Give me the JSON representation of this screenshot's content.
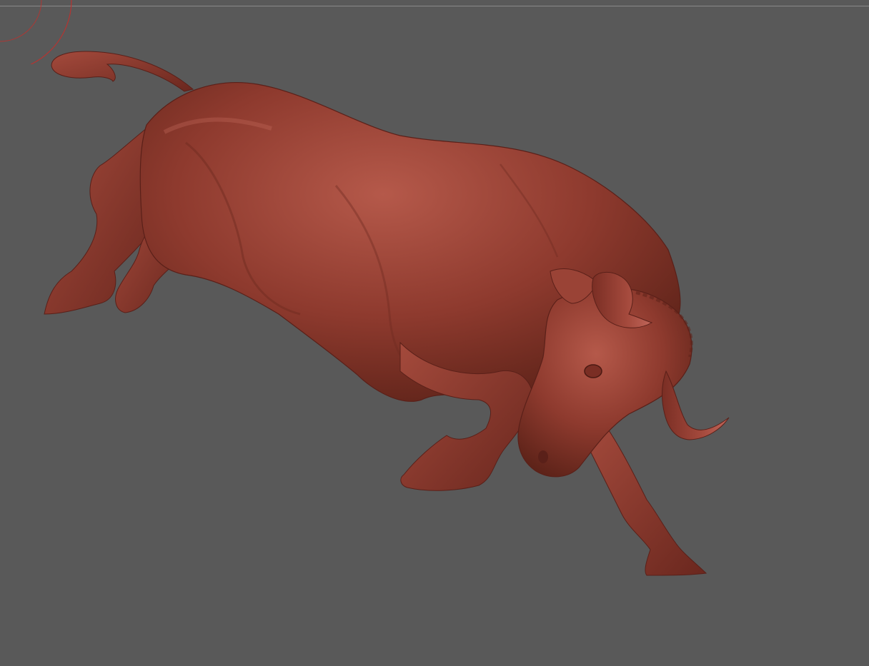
{
  "app": {
    "view": "3d-sculpt-viewport"
  },
  "viewport": {
    "background_color": "#595959",
    "model_subject": "bull-sculpture",
    "material_color": "#8e3a2e",
    "material_highlight": "#b5594a",
    "material_shadow": "#5a2019",
    "brush_cursor_color": "#c0302c"
  }
}
